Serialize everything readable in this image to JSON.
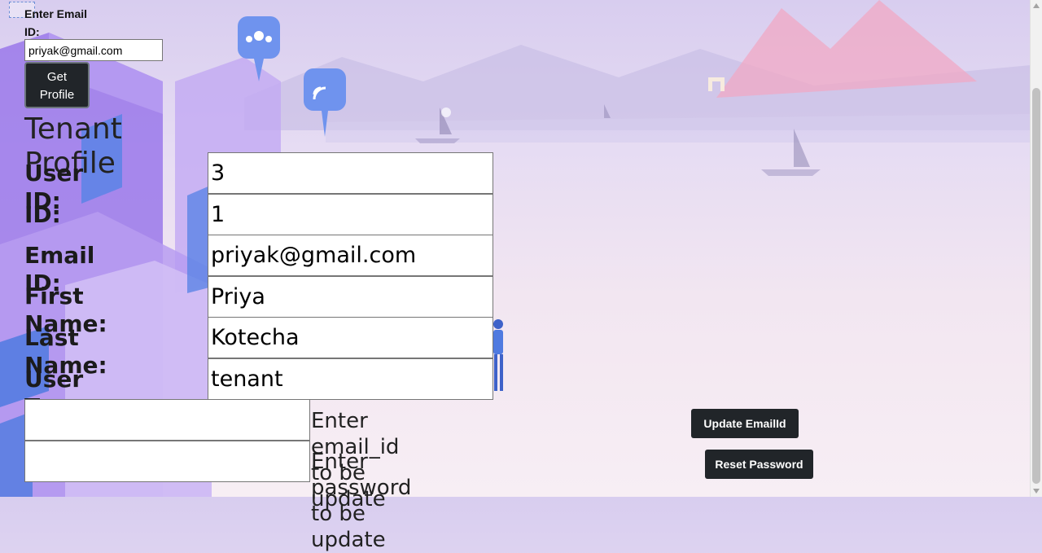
{
  "lookup": {
    "label": "Enter Email ID:",
    "email_value": "priyak@gmail.com",
    "button_label_line1": "Get",
    "button_label_line2": "Profile"
  },
  "profile": {
    "title": "Tenant Profile",
    "fields": [
      {
        "label": "User ID:",
        "value": "3"
      },
      {
        "label": "ID:",
        "value": "1"
      },
      {
        "label": "Email ID:",
        "value": "priyak@gmail.com"
      },
      {
        "label": "First Name:",
        "value": "Priya"
      },
      {
        "label": "Last Name:",
        "value": "Kotecha"
      },
      {
        "label": "User Type:",
        "value": "tenant"
      }
    ]
  },
  "update": {
    "email_prompt": "Enter email_id to be update",
    "email_button": "Update EmailId",
    "password_prompt": "Enter password to be update",
    "password_button": "Reset Password"
  },
  "colors": {
    "button_dark": "#212529",
    "background_lavender": "#e6dcf3",
    "illustration_purple": "#8a63e8",
    "illustration_blue": "#4f7ae0"
  }
}
